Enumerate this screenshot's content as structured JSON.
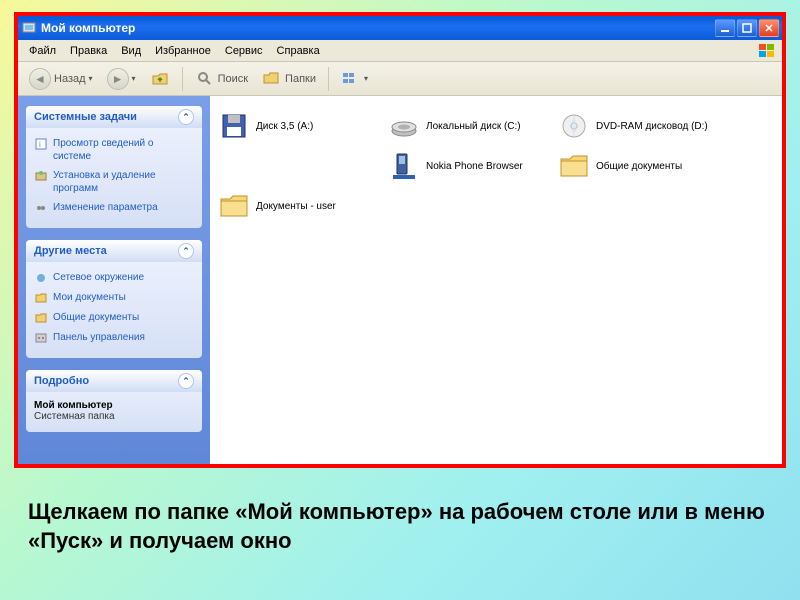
{
  "window": {
    "title": "Мой компьютер",
    "minimize": "_",
    "maximize": "□",
    "close": "✕"
  },
  "menu": {
    "file": "Файл",
    "edit": "Правка",
    "view": "Вид",
    "favorites": "Избранное",
    "tools": "Сервис",
    "help": "Справка"
  },
  "toolbar": {
    "back": "Назад",
    "search": "Поиск",
    "folders": "Папки"
  },
  "sidebar": {
    "panel1": {
      "title": "Системные задачи",
      "links": [
        "Просмотр сведений о системе",
        "Установка и удаление программ",
        "Изменение параметра"
      ]
    },
    "panel2": {
      "title": "Другие места",
      "links": [
        "Сетевое окружение",
        "Мои документы",
        "Общие документы",
        "Панель управления"
      ]
    },
    "panel3": {
      "title": "Подробно",
      "name": "Мой компьютер",
      "type": "Системная папка"
    }
  },
  "items": [
    {
      "label": "Диск 3,5 (A:)"
    },
    {
      "label": "Локальный диск (C:)"
    },
    {
      "label": "DVD-RAM дисковод (D:)"
    },
    {
      "label": ""
    },
    {
      "label": "Nokia Phone Browser"
    },
    {
      "label": "Общие документы"
    },
    {
      "label": "Документы - user"
    }
  ],
  "caption": "Щелкаем по папке «Мой компьютер» на рабочем столе или в меню «Пуск» и получаем окно"
}
